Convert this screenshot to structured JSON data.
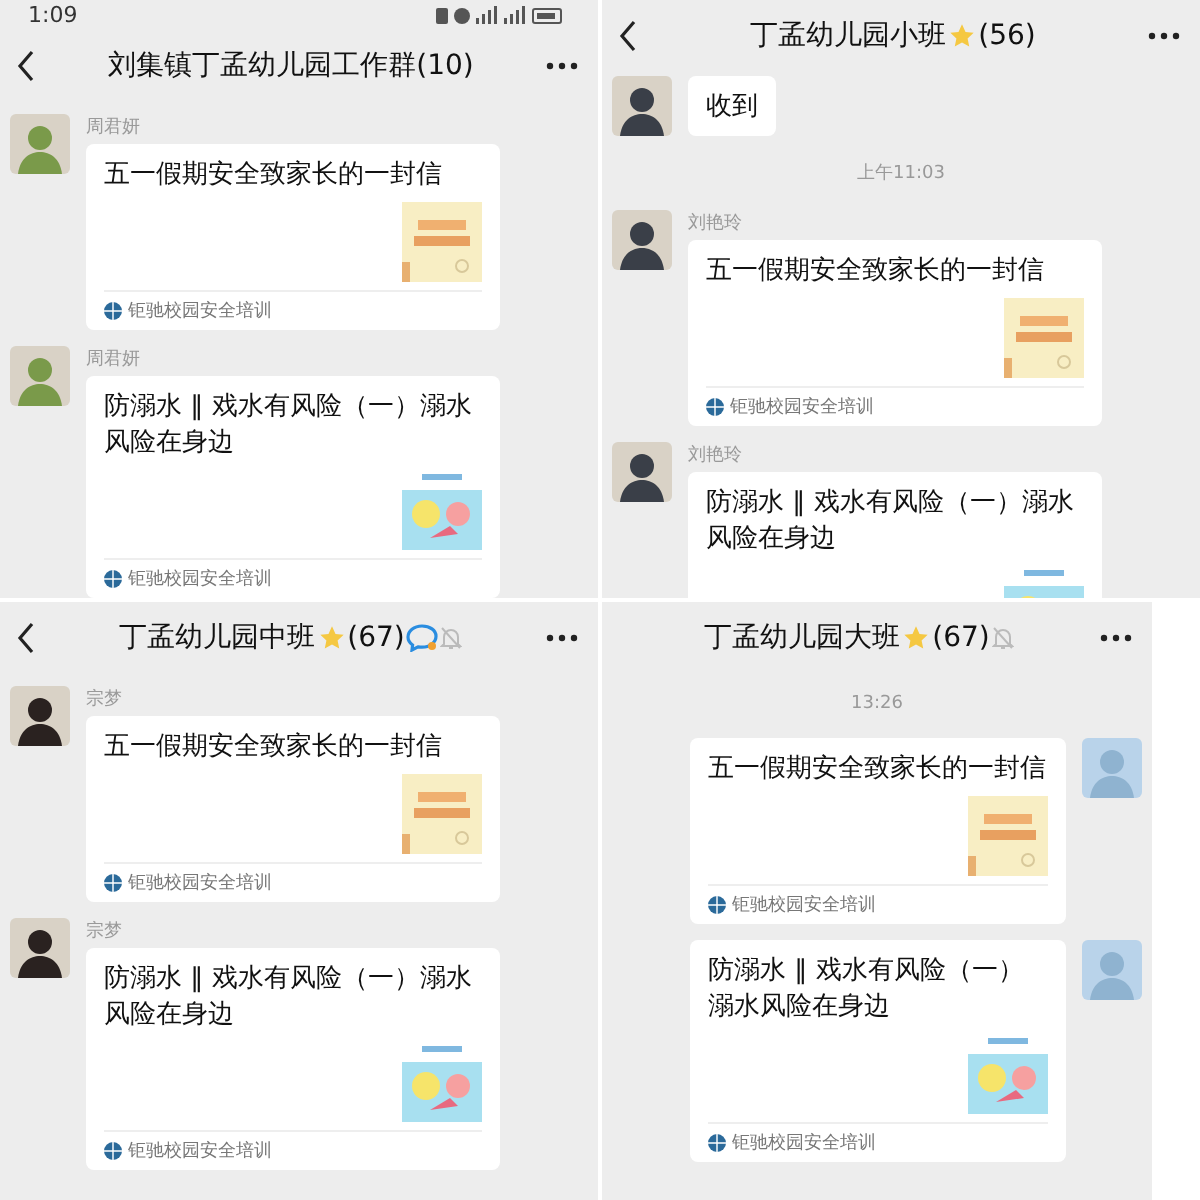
{
  "panels": [
    {
      "status_bar": {
        "time": "1:09"
      },
      "back": true,
      "title": "刘集镇丁孟幼儿园工作群(10)",
      "starred": false,
      "chat_icon": false,
      "muted": false,
      "messages": [
        {
          "kind": "poster",
          "outgoing": false,
          "sender": "周君妍",
          "text": "五一假期安全致家长的一封信",
          "source": "钜驰校园安全培训"
        },
        {
          "kind": "swim",
          "outgoing": false,
          "sender": "周君妍",
          "text": "防溺水 ‖ 戏水有风险（一）溺水风险在身边",
          "source": "钜驰校园安全培训"
        }
      ]
    },
    {
      "back": true,
      "title": "丁孟幼儿园小班",
      "starred": true,
      "count": "(56)",
      "chat_icon": false,
      "muted": false,
      "messages": [
        {
          "kind": "text",
          "outgoing": false,
          "text": "收到"
        },
        {
          "kind": "time",
          "text": "上午11:03"
        },
        {
          "kind": "poster",
          "outgoing": false,
          "sender": "刘艳玲",
          "text": "五一假期安全致家长的一封信",
          "source": "钜驰校园安全培训"
        },
        {
          "kind": "swim",
          "outgoing": false,
          "sender": "刘艳玲",
          "text": "防溺水 ‖ 戏水有风险（一）溺水风险在身边"
        }
      ]
    },
    {
      "back": true,
      "title": "丁孟幼儿园中班",
      "starred": true,
      "count": "(67)",
      "chat_icon": true,
      "muted": true,
      "messages": [
        {
          "kind": "poster",
          "outgoing": false,
          "sender": "宗梦",
          "text": "五一假期安全致家长的一封信",
          "source": "钜驰校园安全培训"
        },
        {
          "kind": "swim",
          "outgoing": false,
          "sender": "宗梦",
          "text": "防溺水 ‖ 戏水有风险（一）溺水风险在身边",
          "source": "钜驰校园安全培训"
        }
      ]
    },
    {
      "back": false,
      "title": "丁孟幼儿园大班",
      "starred": true,
      "count": "(67)",
      "chat_icon": false,
      "muted": true,
      "messages": [
        {
          "kind": "time",
          "text": "13:26"
        },
        {
          "kind": "poster",
          "outgoing": true,
          "text": "五一假期安全致家长的一封信",
          "source": "钜驰校园安全培训"
        },
        {
          "kind": "swim",
          "outgoing": true,
          "text": "防溺水 ‖ 戏水有风险（一）溺水风险在身边",
          "source": "钜驰校园安全培训"
        }
      ]
    }
  ]
}
